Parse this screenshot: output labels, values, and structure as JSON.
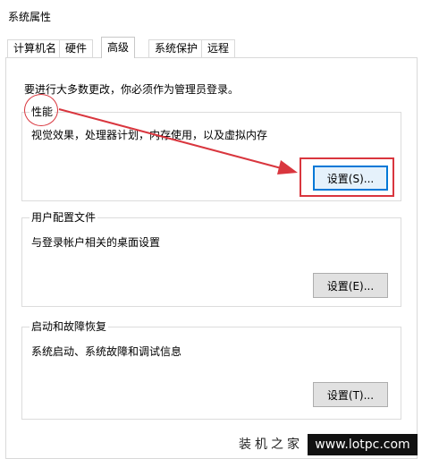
{
  "window": {
    "title": "系统属性"
  },
  "tabs": [
    {
      "label": "计算机名"
    },
    {
      "label": "硬件"
    },
    {
      "label": "高级"
    },
    {
      "label": "系统保护"
    },
    {
      "label": "远程"
    }
  ],
  "active_tab": "高级",
  "panel": {
    "notice": "要进行大多数更改，你必须作为管理员登录。",
    "performance": {
      "title": "性能",
      "description": "视觉效果，处理器计划，内存使用，以及虚拟内存",
      "button": "设置(S)..."
    },
    "user_profiles": {
      "title": "用户配置文件",
      "description": "与登录帐户相关的桌面设置",
      "button": "设置(E)..."
    },
    "startup_recovery": {
      "title": "启动和故障恢复",
      "description": "系统启动、系统故障和调试信息",
      "button": "设置(T)..."
    }
  },
  "watermark": {
    "text": "装机之家",
    "url": "www.lotpc.com"
  },
  "colors": {
    "annotation_red": "#d9363e",
    "focus_blue": "#0078d7"
  }
}
